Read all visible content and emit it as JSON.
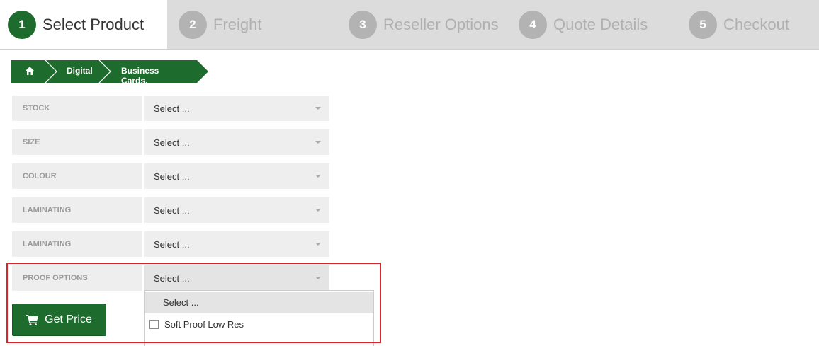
{
  "steps": [
    {
      "number": "1",
      "label": "Select Product",
      "active": true
    },
    {
      "number": "2",
      "label": "Freight",
      "active": false
    },
    {
      "number": "3",
      "label": "Reseller Options",
      "active": false
    },
    {
      "number": "4",
      "label": "Quote Details",
      "active": false
    },
    {
      "number": "5",
      "label": "Checkout",
      "active": false
    }
  ],
  "breadcrumb": {
    "home_icon": "home-icon",
    "items": [
      "Digital",
      "Business Cards."
    ]
  },
  "form": {
    "rows": [
      {
        "label": "STOCK",
        "value": "Select ..."
      },
      {
        "label": "SIZE",
        "value": "Select ..."
      },
      {
        "label": "COLOUR",
        "value": "Select ..."
      },
      {
        "label": "LAMINATING",
        "value": "Select ..."
      },
      {
        "label": "LAMINATING",
        "value": "Select ..."
      },
      {
        "label": "PROOF OPTIONS",
        "value": "Select ...",
        "open": true
      }
    ]
  },
  "dropdown": {
    "highlighted_option": "Select ...",
    "options": [
      "Soft Proof Low Res"
    ]
  },
  "get_price": {
    "label": "Get Price",
    "icon": "shopping-cart-icon"
  },
  "colors": {
    "accent": "#1e6b2e",
    "highlight_border": "#d9242b",
    "step_inactive_bg": "#dcdcdc",
    "field_bg": "#eeeeee"
  }
}
